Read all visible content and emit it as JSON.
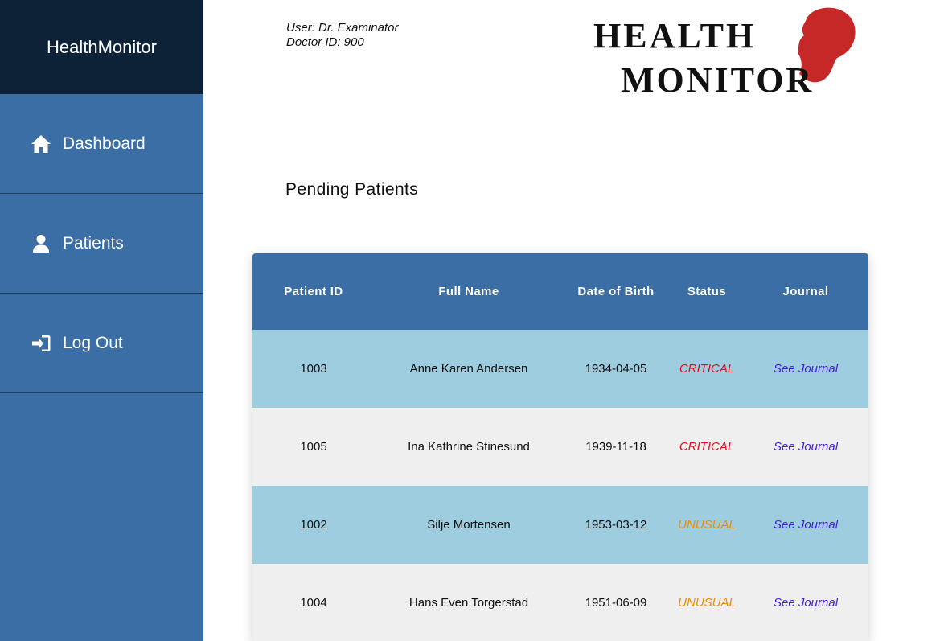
{
  "sidebar": {
    "brand": "HealthMonitor",
    "items": [
      {
        "label": "Dashboard",
        "icon": "home-icon"
      },
      {
        "label": "Patients",
        "icon": "user-icon"
      },
      {
        "label": "Log Out",
        "icon": "sign-in-icon"
      }
    ]
  },
  "user": {
    "name_line": "User: Dr. Examinator",
    "id_line": "Doctor ID: 900"
  },
  "logo": {
    "line1": "HEALTH",
    "line2": "MONITOR"
  },
  "main": {
    "title": "Pending Patients"
  },
  "table": {
    "columns": [
      "Patient ID",
      "Full Name",
      "Date of Birth",
      "Status",
      "Journal"
    ],
    "rows": [
      {
        "id": "1003",
        "name": "Anne Karen Andersen",
        "dob": "1934-04-05",
        "status": "CRITICAL",
        "journal": "See Journal"
      },
      {
        "id": "1005",
        "name": "Ina Kathrine Stinesund",
        "dob": "1939-11-18",
        "status": "CRITICAL",
        "journal": "See Journal"
      },
      {
        "id": "1002",
        "name": "Silje Mortensen",
        "dob": "1953-03-12",
        "status": "UNUSUAL",
        "journal": "See Journal"
      },
      {
        "id": "1004",
        "name": "Hans Even Torgerstad",
        "dob": "1951-06-09",
        "status": "UNUSUAL",
        "journal": "See Journal"
      }
    ]
  },
  "colors": {
    "sidebar": "#3a6ea5",
    "brand_bg": "#0d2236",
    "critical": "#e0101c",
    "unusual": "#f08c00",
    "link": "#4422dd",
    "row_odd": "#9ecde0",
    "row_even": "#f0eff0",
    "logo_red": "#c62828"
  }
}
